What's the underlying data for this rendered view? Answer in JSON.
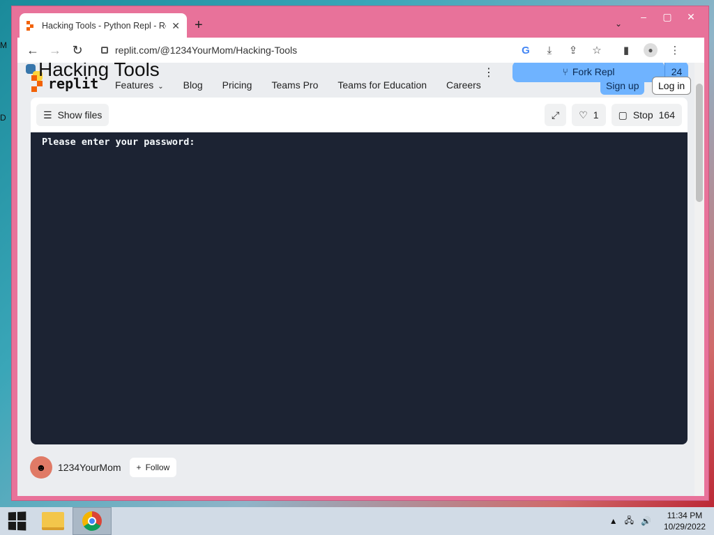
{
  "desktop": {
    "icon_letters": [
      "M",
      "D"
    ]
  },
  "browser": {
    "tab_title": "Hacking Tools - Python Repl - Re",
    "tab_close": "✕",
    "new_tab": "+",
    "tab_search": "⌄",
    "window_controls": {
      "minimize": "‒",
      "maximize": "▢",
      "close": "✕"
    },
    "toolbar": {
      "back": "←",
      "forward": "→",
      "reload": "↻"
    },
    "url": "replit.com/@1234YourMom/Hacking-Tools",
    "icons": {
      "google": "G",
      "install": "⤓",
      "share": "⇪",
      "bookmark": "☆",
      "sidebar": "▮",
      "profile": "●",
      "menu": "⋮"
    }
  },
  "page": {
    "repl_title": "Hacking Tools",
    "more_menu": "⋮",
    "fork_label": "Fork Repl",
    "fork_count": "24",
    "nav": {
      "features": "Features",
      "blog": "Blog",
      "pricing": "Pricing",
      "teams_pro": "Teams Pro",
      "teams_education": "Teams for Education",
      "careers": "Careers"
    },
    "chevron": "⌄",
    "sign_up": "Sign up",
    "log_in": "Log in",
    "replit_word": "replit",
    "replbar": {
      "show_files": "Show files",
      "expand_icon": "⤢",
      "like_icon": "♡",
      "like_count": "1",
      "stop_label": "Stop",
      "stop_count": "164"
    },
    "console_output": "Please enter your password:",
    "author": {
      "name": "1234YourMom",
      "avatar_glyph": "☻",
      "follow_label": "Follow",
      "follow_icon": "+"
    }
  },
  "taskbar": {
    "tray_arrow": "▲",
    "network_icon": "🖧",
    "volume_icon": "🔊",
    "time": "11:34 PM",
    "date": "10/29/2022"
  },
  "colors": {
    "window_frame": "#e8729a",
    "fork_button": "#6fb3ff",
    "console_bg": "#1c2333",
    "replit_orange": "#f26207"
  }
}
